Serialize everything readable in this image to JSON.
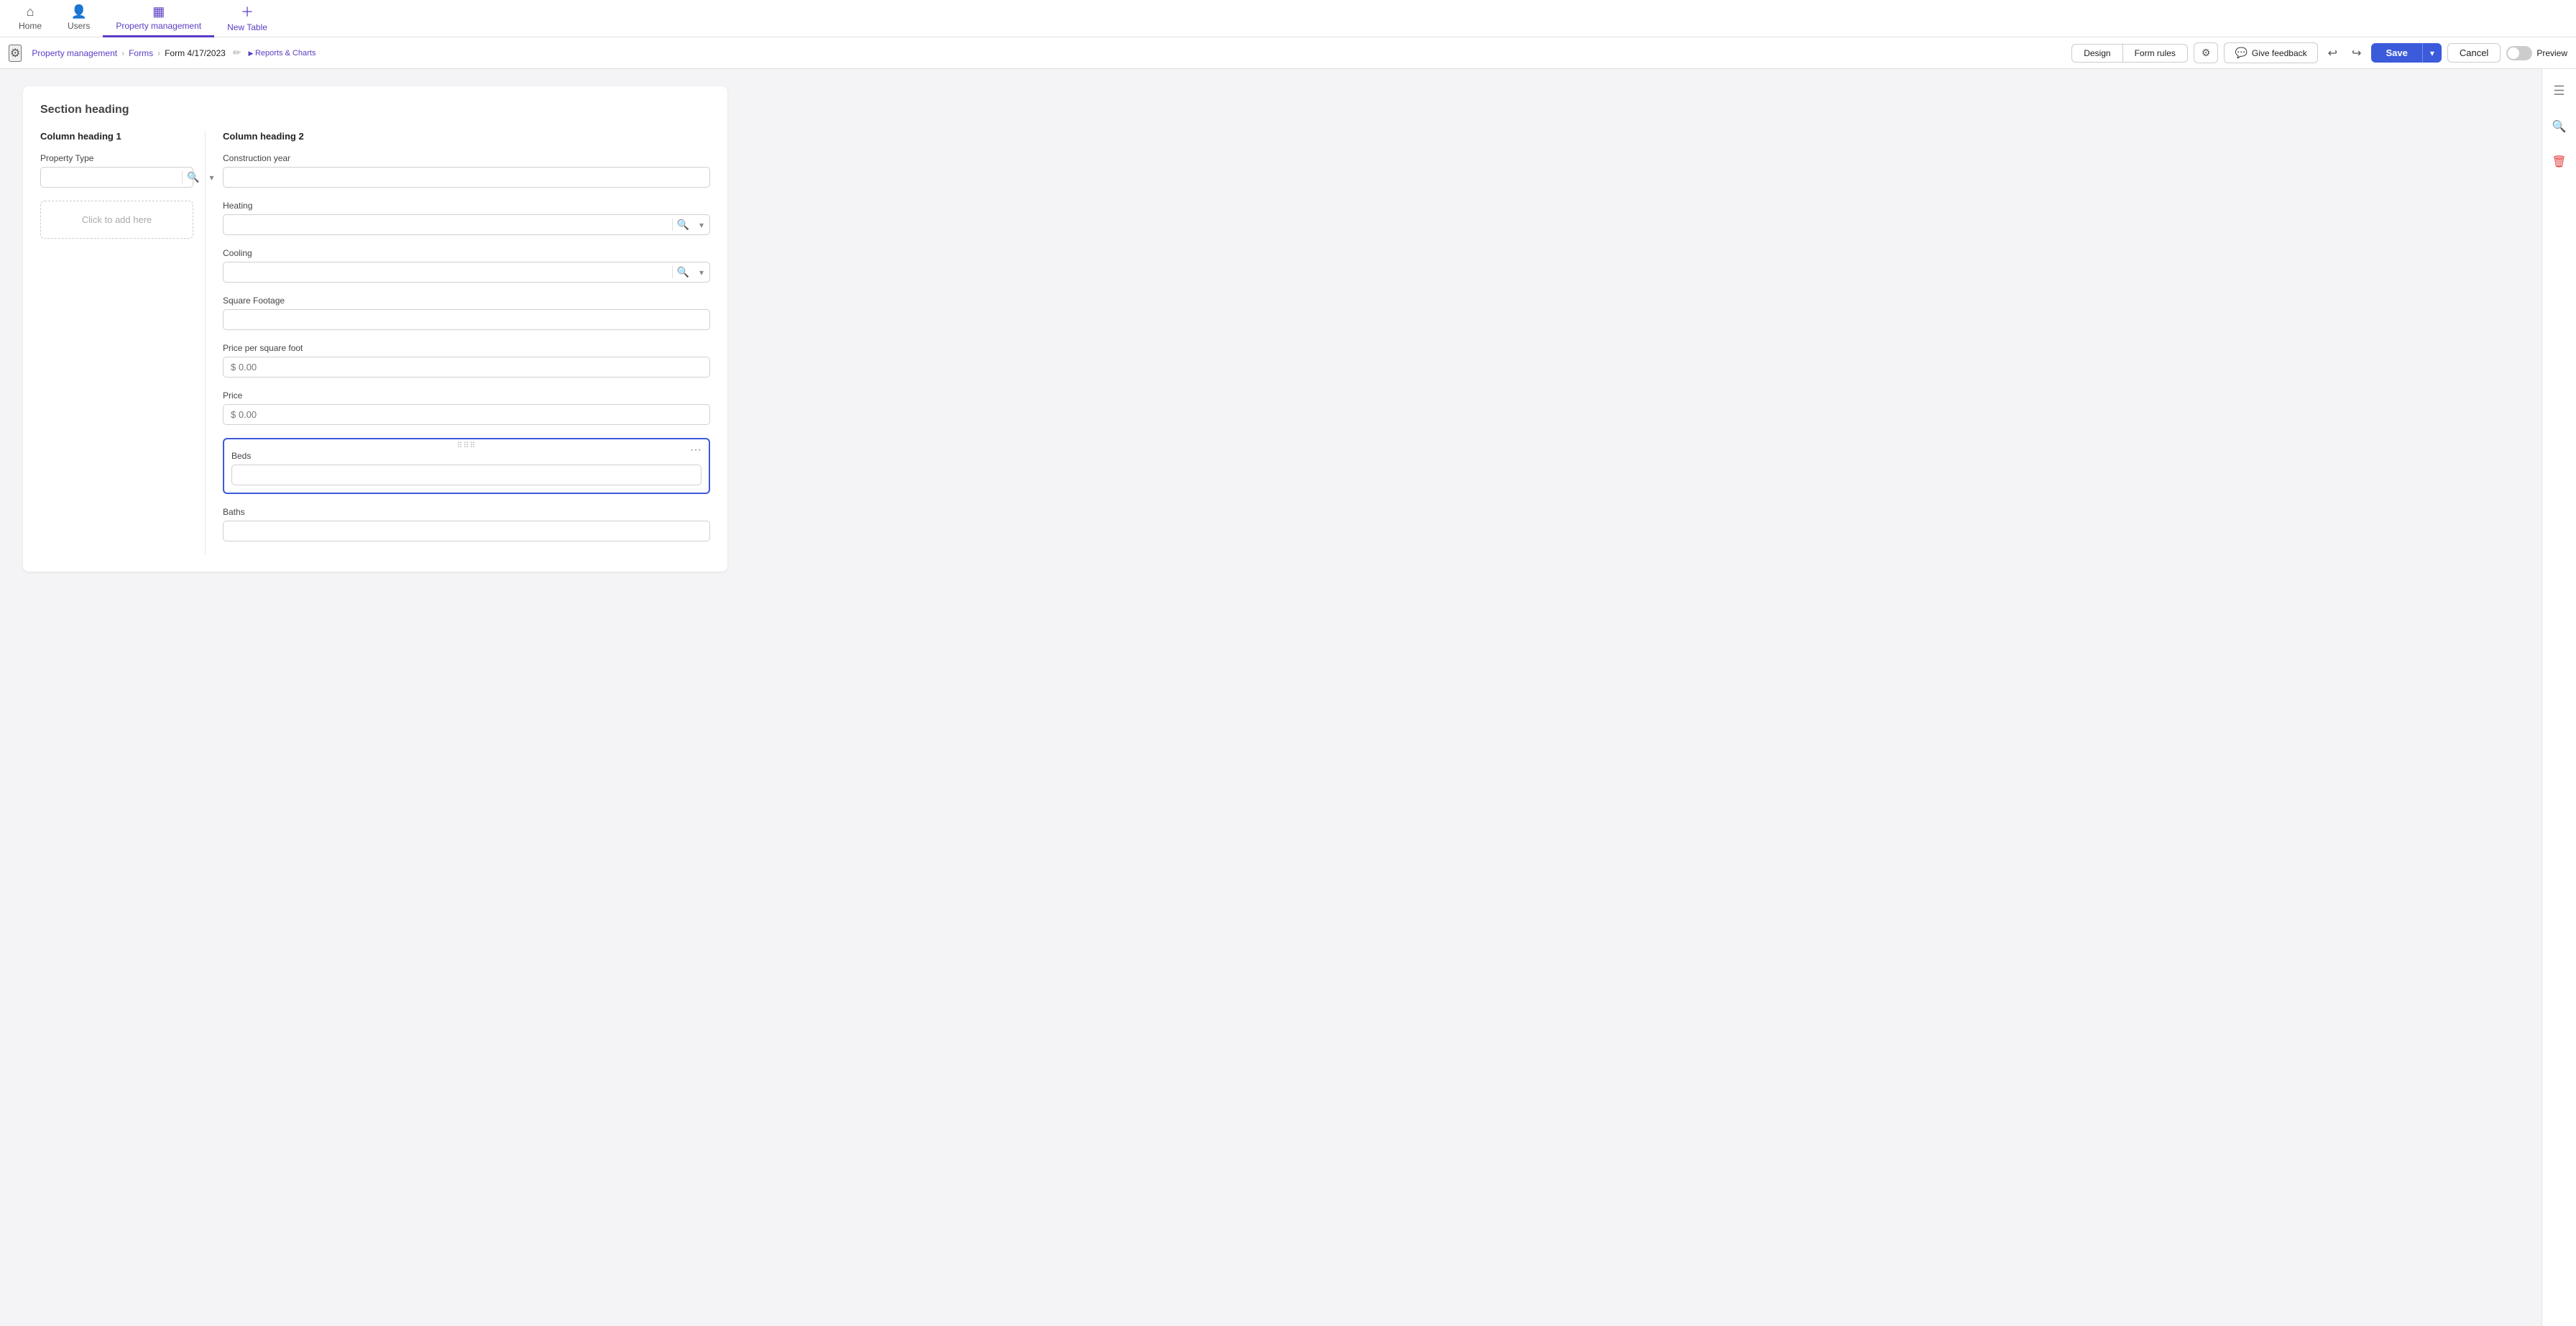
{
  "app": {
    "title": "Property management"
  },
  "topnav": {
    "items": [
      {
        "id": "home",
        "label": "Home",
        "icon": "⌂",
        "active": false
      },
      {
        "id": "users",
        "label": "Users",
        "icon": "👤",
        "active": false
      },
      {
        "id": "property-management",
        "label": "Property management",
        "icon": "▦",
        "active": true
      },
      {
        "id": "new-table",
        "label": "New Table",
        "icon": "+",
        "active": false,
        "is_add": true
      }
    ]
  },
  "breadcrumb": {
    "app": "Property management",
    "section": "Forms",
    "page": "Form 4/17/2023",
    "sub": "Reports & Charts"
  },
  "toolbar": {
    "design_label": "Design",
    "form_rules_label": "Form rules",
    "feedback_label": "Give feedback",
    "undo_icon": "↩",
    "redo_icon": "↪",
    "save_label": "Save",
    "cancel_label": "Cancel",
    "preview_label": "Preview"
  },
  "form": {
    "section_heading": "Section heading",
    "col1_heading": "Column heading 1",
    "col2_heading": "Column heading 2",
    "col1_fields": [
      {
        "id": "property-type",
        "label": "Property Type",
        "type": "search-dropdown",
        "value": "",
        "placeholder": ""
      }
    ],
    "col1_add_label": "Click to add here",
    "col2_fields": [
      {
        "id": "construction-year",
        "label": "Construction year",
        "type": "text",
        "value": "",
        "placeholder": ""
      },
      {
        "id": "heating",
        "label": "Heating",
        "type": "search-dropdown",
        "value": "",
        "placeholder": ""
      },
      {
        "id": "cooling",
        "label": "Cooling",
        "type": "search-dropdown",
        "value": "",
        "placeholder": ""
      },
      {
        "id": "square-footage",
        "label": "Square Footage",
        "type": "text",
        "value": "",
        "placeholder": ""
      },
      {
        "id": "price-per-sqft",
        "label": "Price per square foot",
        "type": "currency",
        "value": "",
        "placeholder": "$ 0.00"
      },
      {
        "id": "price",
        "label": "Price",
        "type": "currency",
        "value": "",
        "placeholder": "$ 0.00"
      },
      {
        "id": "beds",
        "label": "Beds",
        "type": "text",
        "value": "",
        "placeholder": "",
        "active": true
      },
      {
        "id": "baths",
        "label": "Baths",
        "type": "text",
        "value": "",
        "placeholder": ""
      }
    ]
  },
  "right_sidebar": {
    "icons": [
      {
        "id": "settings",
        "icon": "≡",
        "label": "settings-icon"
      },
      {
        "id": "search",
        "icon": "🔍",
        "label": "search-icon"
      },
      {
        "id": "delete",
        "icon": "🗑",
        "label": "delete-icon"
      }
    ]
  }
}
